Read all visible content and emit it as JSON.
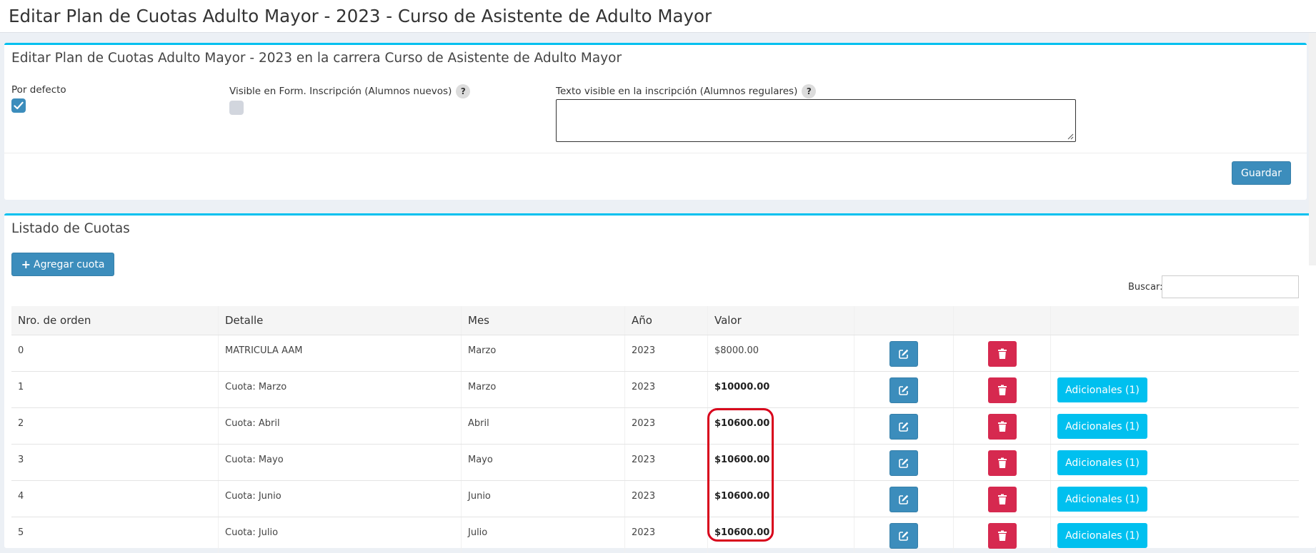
{
  "page": {
    "title": "Editar Plan de Cuotas Adulto Mayor - 2023 - Curso de Asistente de Adulto Mayor"
  },
  "edit_box": {
    "title": "Editar Plan de Cuotas Adulto Mayor - 2023 en la carrera Curso de Asistente de Adulto Mayor",
    "por_defecto_label": "Por defecto",
    "por_defecto_checked": true,
    "visible_form_label": "Visible en Form. Inscripción (Alumnos nuevos)",
    "visible_form_checked": false,
    "texto_visible_label": "Texto visible en la inscripción (Alumnos regulares)",
    "texto_visible_value": "",
    "help_symbol": "?",
    "save_label": "Guardar"
  },
  "list_box": {
    "title": "Listado de Cuotas",
    "add_label": "Agregar cuota",
    "add_icon": "plus-icon",
    "search_label": "Buscar:",
    "search_value": "",
    "columns": [
      "Nro. de orden",
      "Detalle",
      "Mes",
      "Año",
      "Valor",
      "",
      "",
      ""
    ],
    "rows": [
      {
        "orden": "0",
        "detalle": "MATRICULA AAM",
        "mes": "Marzo",
        "anio": "2023",
        "valor": "$8000.00",
        "adicionales": ""
      },
      {
        "orden": "1",
        "detalle": "Cuota: Marzo",
        "mes": "Marzo",
        "anio": "2023",
        "valor": "$10000.00",
        "adicionales": "Adicionales (1)"
      },
      {
        "orden": "2",
        "detalle": "Cuota: Abril",
        "mes": "Abril",
        "anio": "2023",
        "valor": "$10600.00",
        "adicionales": "Adicionales (1)"
      },
      {
        "orden": "3",
        "detalle": "Cuota: Mayo",
        "mes": "Mayo",
        "anio": "2023",
        "valor": "$10600.00",
        "adicionales": "Adicionales (1)"
      },
      {
        "orden": "4",
        "detalle": "Cuota: Junio",
        "mes": "Junio",
        "anio": "2023",
        "valor": "$10600.00",
        "adicionales": "Adicionales (1)"
      },
      {
        "orden": "5",
        "detalle": "Cuota: Julio",
        "mes": "Julio",
        "anio": "2023",
        "valor": "$10600.00",
        "adicionales": "Adicionales (1)"
      }
    ]
  },
  "colors": {
    "accent": "#3c8dbc",
    "info": "#00c0ef",
    "danger": "#d6294f",
    "highlight": "#d8001b"
  }
}
